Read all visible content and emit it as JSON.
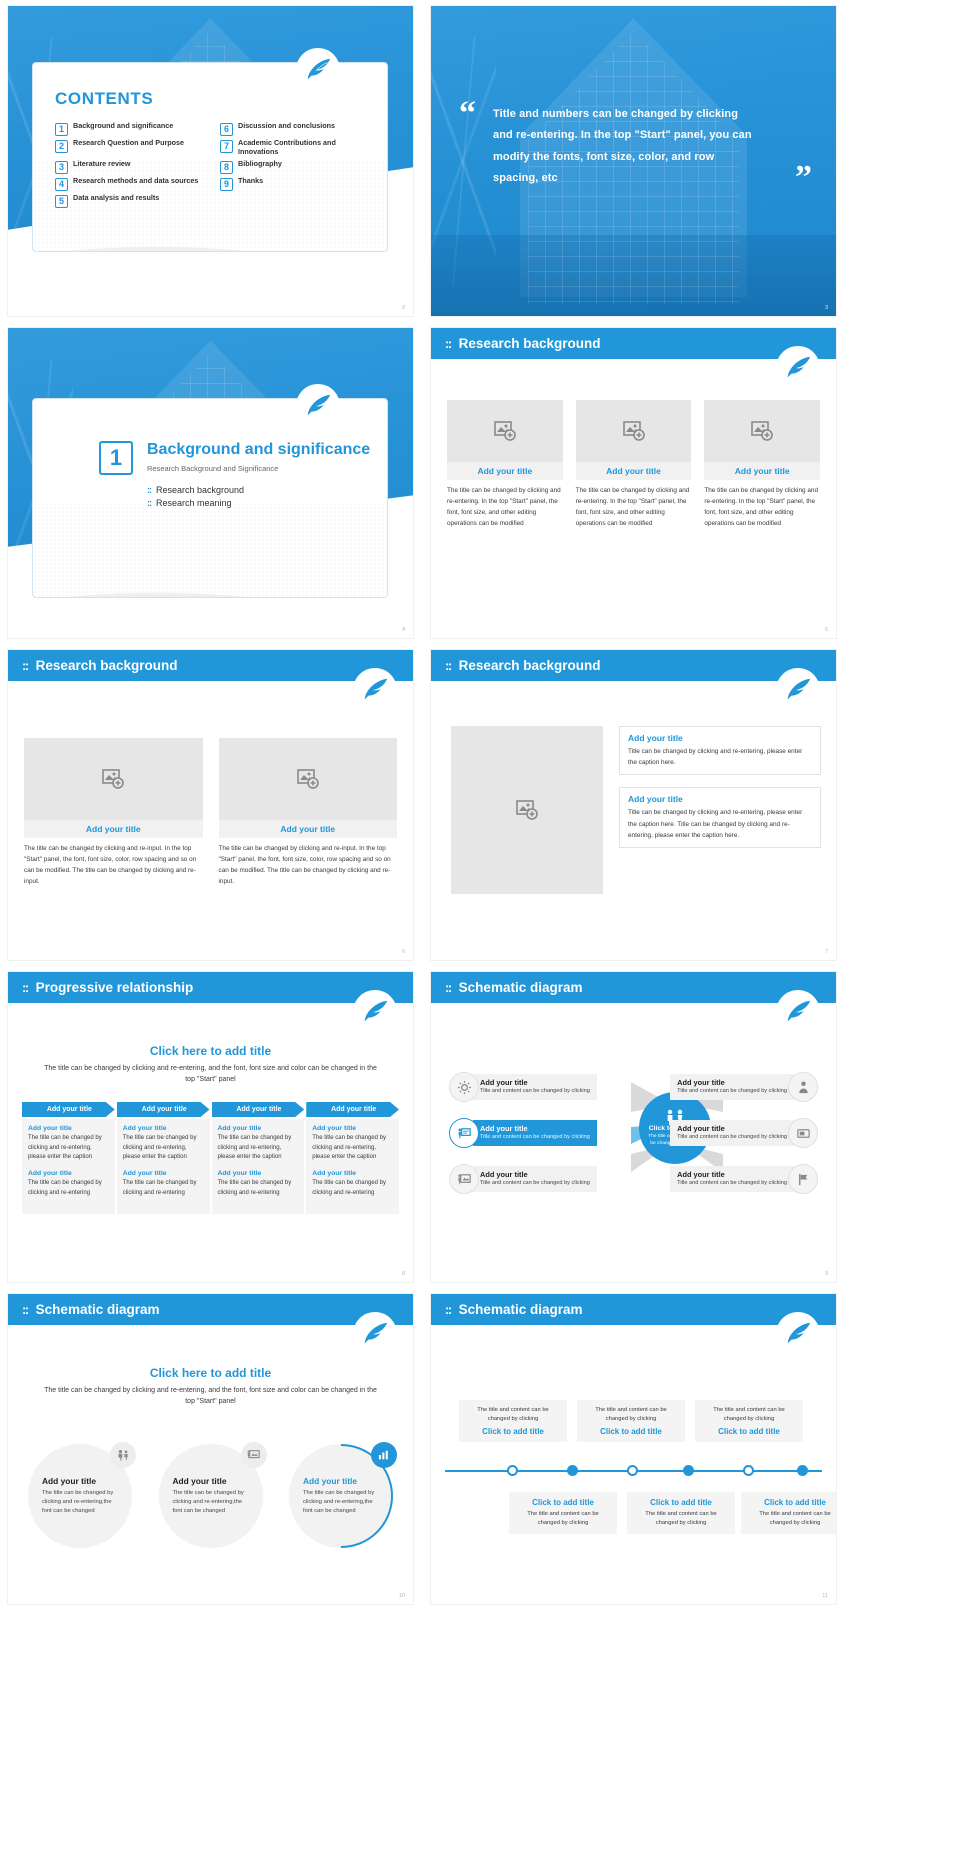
{
  "brand": {
    "accent": "#2196d8",
    "light_gray": "#e6e6e6",
    "caption_bg": "#f1f1f1"
  },
  "slides": [
    {
      "page": "2",
      "type": "contents",
      "title": "CONTENTS",
      "items": [
        {
          "num": "1",
          "label": "Background and significance"
        },
        {
          "num": "2",
          "label": "Research Question and Purpose"
        },
        {
          "num": "3",
          "label": "Literature review"
        },
        {
          "num": "4",
          "label": "Research methods and data sources"
        },
        {
          "num": "5",
          "label": "Data analysis and results"
        },
        {
          "num": "6",
          "label": "Discussion and conclusions"
        },
        {
          "num": "7",
          "label": "Academic Contributions and Innovations"
        },
        {
          "num": "8",
          "label": "Bibliography"
        },
        {
          "num": "9",
          "label": "Thanks"
        }
      ]
    },
    {
      "page": "3",
      "type": "quote",
      "open_quote": "“",
      "close_quote": "”",
      "text": "Title and numbers can be changed by clicking and re-entering. In the top \"Start\" panel, you can modify the fonts, font size, color, and row spacing, etc"
    },
    {
      "page": "4",
      "type": "section",
      "number": "1",
      "title": "Background and significance",
      "subtitle": "Research Background and Significance",
      "bullets": [
        "Research background",
        "Research meaning"
      ]
    },
    {
      "page": "5",
      "type": "three-image",
      "header": "Research background",
      "columns": [
        {
          "caption": "Add your title",
          "body": "The title can be changed by clicking and re-entering. In the top \"Start\" panel, the font, font size, and other editing operations can be modified"
        },
        {
          "caption": "Add your title",
          "body": "The title can be changed by clicking and re-entering. In the top \"Start\" panel, the font, font size, and other editing operations can be modified"
        },
        {
          "caption": "Add your title",
          "body": "The title can be changed by clicking and re-entering. In the top \"Start\" panel, the font, font size, and other editing operations can be modified"
        }
      ]
    },
    {
      "page": "6",
      "type": "two-image",
      "header": "Research background",
      "columns": [
        {
          "caption": "Add your title",
          "body": "The title can be changed by clicking and re-input. In the top \"Start\" panel, the font, font size, color, row spacing and so on can be modified. The title can be changed by clicking and re-input."
        },
        {
          "caption": "Add your title",
          "body": "The title can be changed by clicking and re-input. In the top \"Start\" panel, the font, font size, color, row spacing and so on can be modified. The title can be changed by clicking and re-input."
        }
      ]
    },
    {
      "page": "7",
      "type": "image-left",
      "header": "Research background",
      "boxes": [
        {
          "title": "Add your title",
          "body": "Title can be changed by clicking and re-entering, please enter the caption here."
        },
        {
          "title": "Add your title",
          "body": "Title can be changed by clicking and re-entering, please enter the caption here. Title can be changed by clicking and re-entering, please enter the caption here."
        }
      ]
    },
    {
      "page": "8",
      "type": "progressive",
      "header": "Progressive relationship",
      "center_title": "Click here to add title",
      "center_sub": "The title can be changed by clicking and re-entering, and the font, font size and color can be changed in the top \"Start\" panel",
      "chevrons": [
        "Add your title",
        "Add your title",
        "Add your title",
        "Add your title"
      ],
      "columns": [
        {
          "t1": "Add your title",
          "p1": "The title can be changed by clicking and re-entering, please enter the caption",
          "t2": "Add your title",
          "p2": "The title can be changed by clicking and re-entering"
        },
        {
          "t1": "Add your title",
          "p1": "The title can be changed by clicking and re-entering, please enter the caption",
          "t2": "Add your title",
          "p2": "The title can be changed by clicking and re-entering"
        },
        {
          "t1": "Add your title",
          "p1": "The title can be changed by clicking and re-entering, please enter the caption",
          "t2": "Add your title",
          "p2": "The title can be changed by clicking and re-entering"
        },
        {
          "t1": "Add your title",
          "p1": "The title can be changed by clicking and re-entering, please enter the caption",
          "t2": "Add your title",
          "p2": "The title can be changed by clicking and re-entering"
        }
      ]
    },
    {
      "page": "9",
      "type": "radial",
      "header": "Schematic diagram",
      "hub_title": "Click to add title",
      "hub_sub": "The title and content can be changed by clicking",
      "nodes": [
        {
          "side": "left",
          "icon": "gear-icon",
          "title": "Add your title",
          "body": "Title and content can be changed by clicking",
          "highlight": false
        },
        {
          "side": "left",
          "icon": "presenter-icon",
          "title": "Add your title",
          "body": "Title and content can be changed by clicking",
          "highlight": true
        },
        {
          "side": "left",
          "icon": "board-icon",
          "title": "Add your title",
          "body": "Title and content can be changed by clicking",
          "highlight": false
        },
        {
          "side": "right",
          "icon": "person-icon",
          "title": "Add your title",
          "body": "Title and content can be changed by clicking",
          "highlight": false
        },
        {
          "side": "right",
          "icon": "device-icon",
          "title": "Add your title",
          "body": "Title and content can be changed by clicking",
          "highlight": false
        },
        {
          "side": "right",
          "icon": "flag-icon",
          "title": "Add your title",
          "body": "Title and content can be changed by clicking",
          "highlight": false
        }
      ]
    },
    {
      "page": "10",
      "type": "circles",
      "header": "Schematic diagram",
      "center_title": "Click here to add title",
      "center_sub": "The title can be changed by clicking and re-entering, and the font, font size and color can be changed in the top \"Start\" panel",
      "circles": [
        {
          "icon": "people-icon",
          "title": "Add your title",
          "body": "The title can be changed by clicking and re-entering,the font can be changed",
          "active": false
        },
        {
          "icon": "screen-icon",
          "title": "Add your title",
          "body": "The title can be changed by clicking and re-entering,the font can be changed",
          "active": false
        },
        {
          "icon": "chart-icon",
          "title": "Add your title",
          "body": "The title can be changed by clicking and re-entering,the font can be changed",
          "active": true
        }
      ]
    },
    {
      "page": "11",
      "type": "timeline",
      "header": "Schematic diagram",
      "top_cards": [
        {
          "body": "The title and content can be changed by clicking",
          "title": "Click to add title"
        },
        {
          "body": "The title and content can be changed by clicking",
          "title": "Click to add title"
        },
        {
          "body": "The title and content can be changed by clicking",
          "title": "Click to add title"
        }
      ],
      "bottom_cards": [
        {
          "title": "Click to add title",
          "body": "The title and content can be changed by clicking"
        },
        {
          "title": "Click to add title",
          "body": "The title and content can be changed by clicking"
        },
        {
          "title": "Click to add title",
          "body": "The title and content can be changed by clicking"
        }
      ]
    }
  ]
}
